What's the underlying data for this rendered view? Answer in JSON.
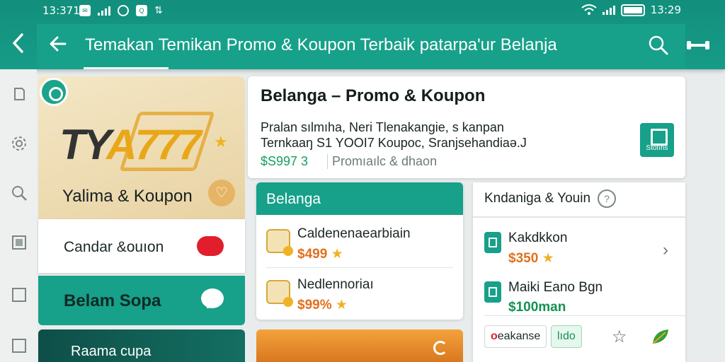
{
  "status_bar": {
    "time_left": "13:371",
    "time_right": "13:29"
  },
  "app_bar": {
    "title": "Temakan Temikan Promo & Koupon Terbaik patarpa'ur Belanja"
  },
  "rail": {
    "icons": [
      "page-icon",
      "gear-icon",
      "search-icon",
      "list-icon",
      "square-icon",
      "square-icon"
    ]
  },
  "hero_card": {
    "logo_dark": "TY",
    "logo_accent": "A777",
    "title": "Yalima & Koupon"
  },
  "row_card": {
    "label": "Candar &ouıon"
  },
  "teal_card": {
    "label": "Belam Sopa"
  },
  "dark_card": {
    "label": "Raama cupa"
  },
  "main_card": {
    "title": "Belanga – Promo & Koupon",
    "desc_line1": "Pralan sılmıha, Neri Tlenakangie, s kanpan",
    "desc_line2": "Ternkaaŋ S1 YOOI7 Koupoc, Sranjsehandiaə.J",
    "price": "$S997 3",
    "price_desc": "Promıaılc & dhaon",
    "store_label": "Stotıhs"
  },
  "list_card": {
    "header": "Belanga",
    "items": [
      {
        "title": "Caldenenaearbiain",
        "price": "$499"
      },
      {
        "title": "Nedlennoriaı",
        "price": "$99%"
      }
    ]
  },
  "side_card": {
    "header": "Kndaniga & Youin",
    "items": [
      {
        "title": "Kakdkkon",
        "price": "$350",
        "price_color": "#e2701d"
      },
      {
        "title": "Maiki Eano Bgn",
        "price": "$100man",
        "price_color": "#149152"
      }
    ],
    "tags": [
      "eakanse",
      "lıdo"
    ]
  },
  "colors": {
    "teal": "#17a08a",
    "accent_orange": "#e2701d",
    "accent_red": "#e21e2d",
    "green_price": "#16a05a"
  }
}
